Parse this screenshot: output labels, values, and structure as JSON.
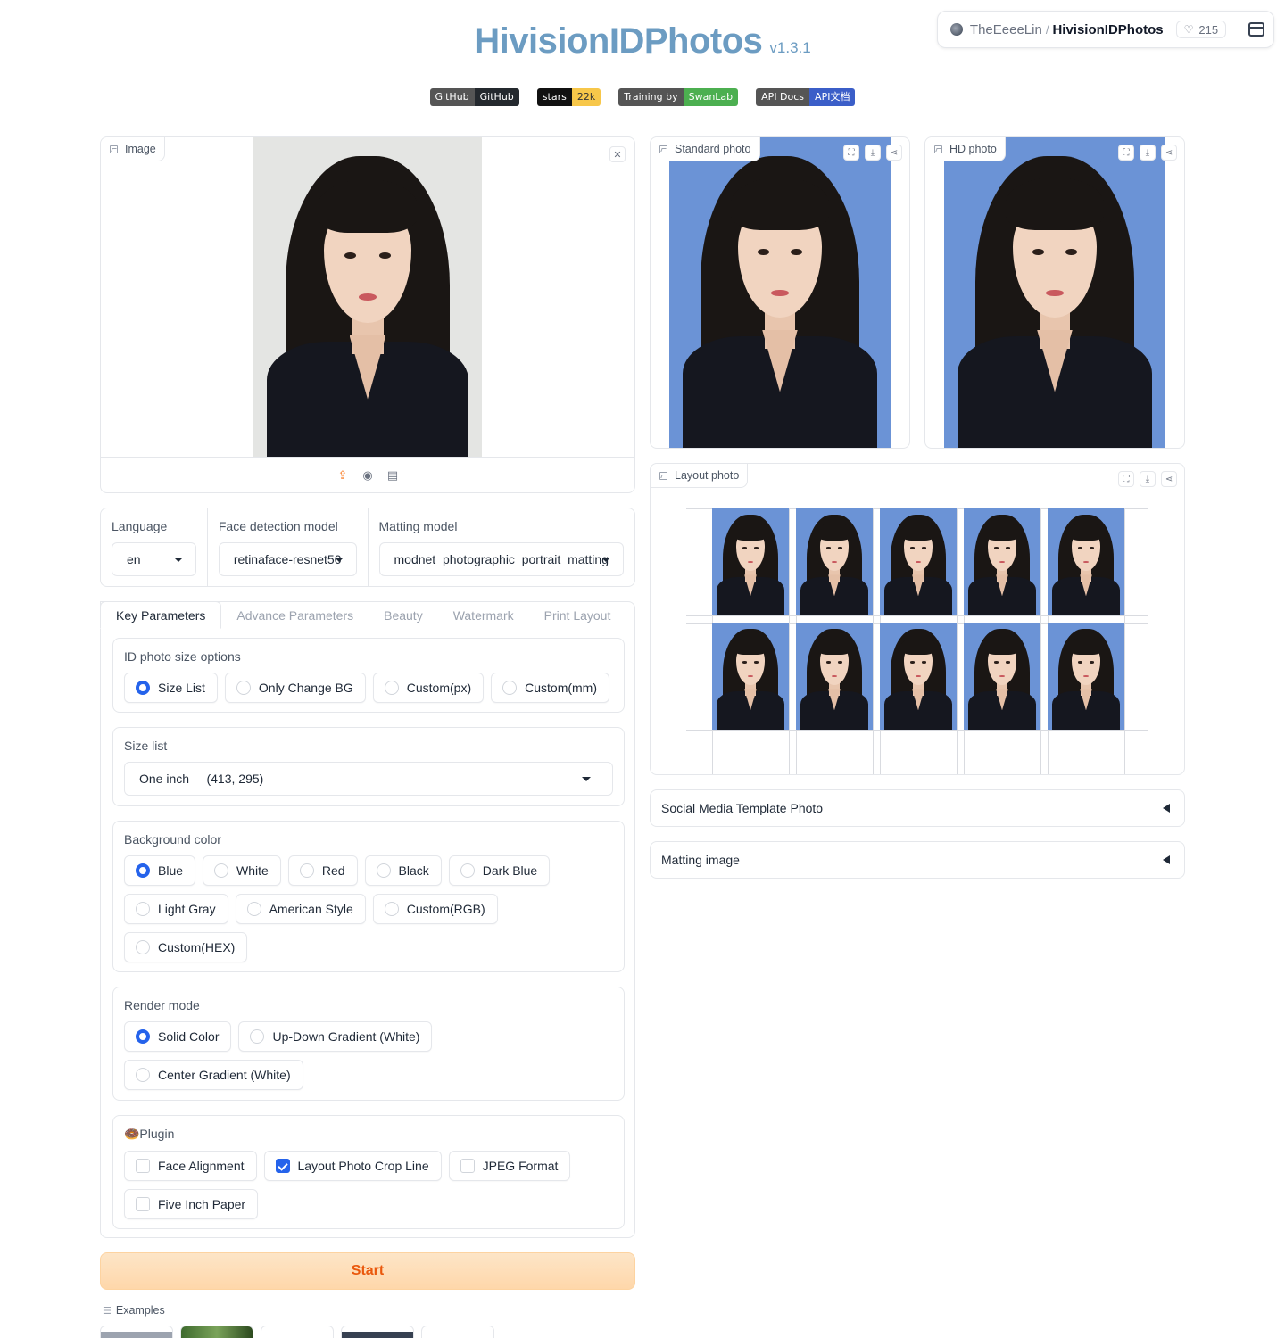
{
  "hf_badge": {
    "owner": "TheEeeeLin",
    "separator": "/",
    "repo": "HivisionIDPhotos",
    "likes": "215"
  },
  "header": {
    "title": "HivisionIDPhotos",
    "version": "v1.3.1",
    "badges": [
      {
        "left": "GitHub",
        "right": "GitHub"
      },
      {
        "left": "stars",
        "right": "22k"
      },
      {
        "left": "Training by",
        "right": "SwanLab"
      },
      {
        "left": "API Docs",
        "right": "API文档"
      }
    ]
  },
  "input_image": {
    "label": "Image"
  },
  "outputs": {
    "standard_label": "Standard photo",
    "hd_label": "HD photo",
    "layout_label": "Layout photo",
    "background_color": "#6b93d6"
  },
  "selectors": {
    "language": {
      "label": "Language",
      "value": "en"
    },
    "face_model": {
      "label": "Face detection model",
      "value": "retinaface-resnet50"
    },
    "matting_model": {
      "label": "Matting model",
      "value": "modnet_photographic_portrait_matting"
    }
  },
  "tabs": [
    "Key Parameters",
    "Advance Parameters",
    "Beauty",
    "Watermark",
    "Print Layout"
  ],
  "size_options": {
    "label": "ID photo size options",
    "options": [
      "Size List",
      "Only Change BG",
      "Custom(px)",
      "Custom(mm)"
    ],
    "selected": "Size List"
  },
  "size_list": {
    "label": "Size list",
    "value": "One inch     (413, 295)"
  },
  "background_color": {
    "label": "Background color",
    "options": [
      "Blue",
      "White",
      "Red",
      "Black",
      "Dark Blue",
      "Light Gray",
      "American Style",
      "Custom(RGB)",
      "Custom(HEX)"
    ],
    "selected": "Blue"
  },
  "render_mode": {
    "label": "Render mode",
    "options": [
      "Solid Color",
      "Up-Down Gradient (White)",
      "Center Gradient (White)"
    ],
    "selected": "Solid Color"
  },
  "plugin": {
    "label": "🍩Plugin",
    "options": [
      {
        "label": "Face Alignment",
        "checked": false
      },
      {
        "label": "Layout Photo Crop Line",
        "checked": true
      },
      {
        "label": "JPEG Format",
        "checked": false
      },
      {
        "label": "Five Inch Paper",
        "checked": false
      }
    ]
  },
  "start_label": "Start",
  "examples_label": "Examples",
  "accordions": [
    "Social Media Template Photo",
    "Matting image"
  ],
  "colors": {
    "accent": "#2563eb",
    "title": "#6c9cc2",
    "start_text": "#ea580c"
  }
}
